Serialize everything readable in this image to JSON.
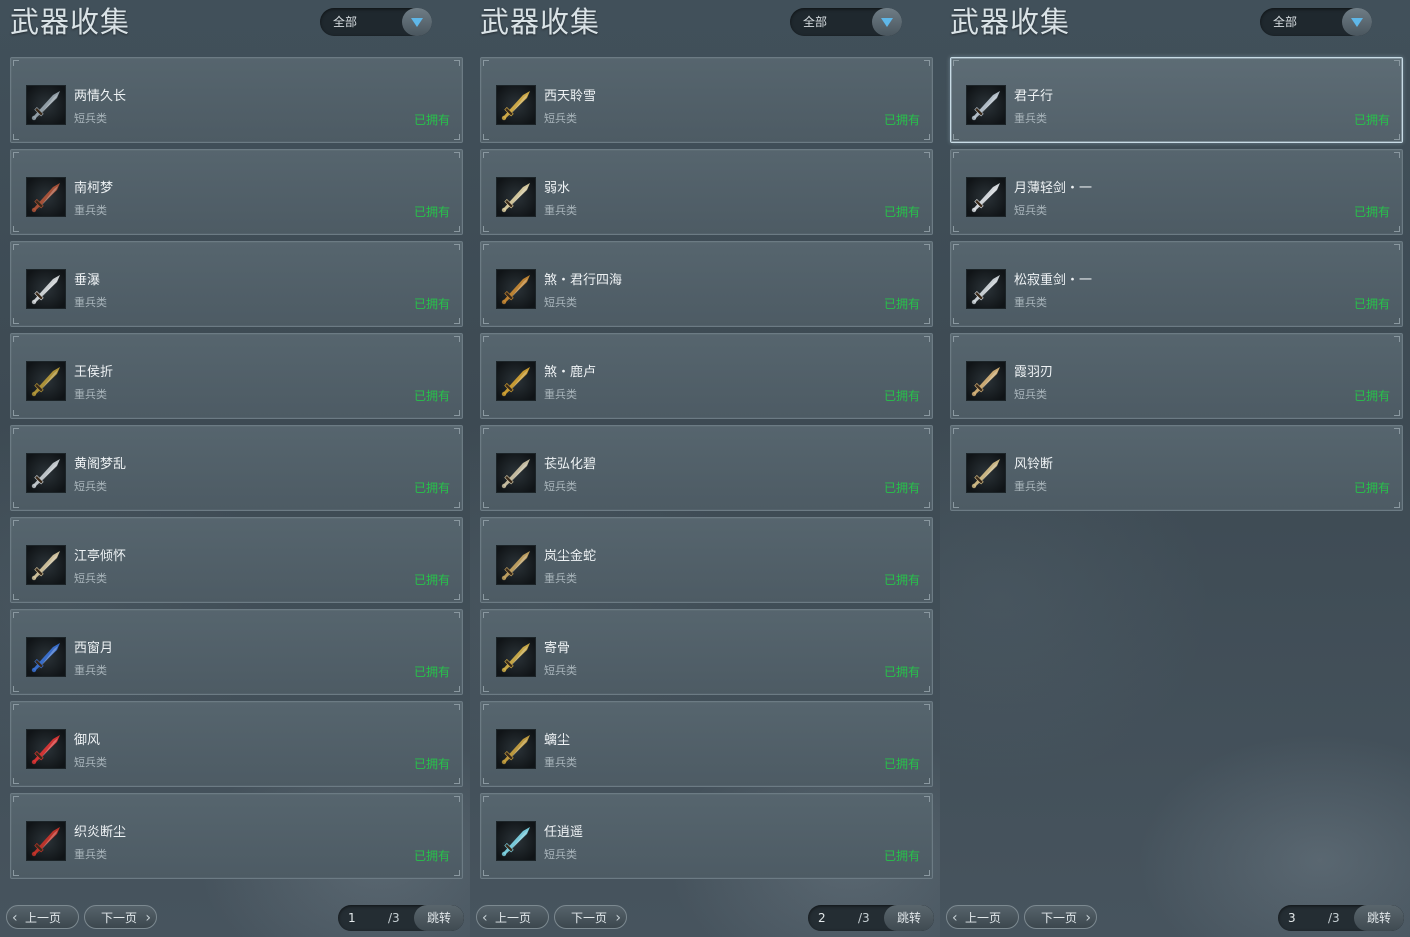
{
  "panels": [
    {
      "title": "武器收集",
      "filter_value": "全部",
      "items": [
        {
          "name": "两情久长",
          "category": "短兵类",
          "status": "已拥有",
          "icon": "sword-icon",
          "color": "#9aa7b0"
        },
        {
          "name": "南柯梦",
          "category": "重兵类",
          "status": "已拥有",
          "icon": "meat-icon",
          "color": "#b0553a"
        },
        {
          "name": "垂瀑",
          "category": "重兵类",
          "status": "已拥有",
          "icon": "curved-blade-icon",
          "color": "#d9dde0"
        },
        {
          "name": "王侯折",
          "category": "重兵类",
          "status": "已拥有",
          "icon": "bracer-icon",
          "color": "#b79a3a"
        },
        {
          "name": "黄阁梦乱",
          "category": "短兵类",
          "status": "已拥有",
          "icon": "axe-icon",
          "color": "#c9cfd4"
        },
        {
          "name": "江亭倾怀",
          "category": "短兵类",
          "status": "已拥有",
          "icon": "dagger-icon",
          "color": "#d8c9a2"
        },
        {
          "name": "西窗月",
          "category": "重兵类",
          "status": "已拥有",
          "icon": "blue-blade-icon",
          "color": "#3b73d6"
        },
        {
          "name": "御风",
          "category": "短兵类",
          "status": "已拥有",
          "icon": "red-wind-icon",
          "color": "#e03535"
        },
        {
          "name": "织炎断尘",
          "category": "重兵类",
          "status": "已拥有",
          "icon": "flame-icon",
          "color": "#c9342a"
        }
      ],
      "pager": {
        "prev": "上一页",
        "next": "下一页",
        "current": "1",
        "total": "/3",
        "jump": "跳转"
      }
    },
    {
      "title": "武器收集",
      "filter_value": "全部",
      "items": [
        {
          "name": "西天聆雪",
          "category": "短兵类",
          "status": "已拥有",
          "icon": "ornate-sword-icon",
          "color": "#d9b24a"
        },
        {
          "name": "弱水",
          "category": "重兵类",
          "status": "已拥有",
          "icon": "long-blade-icon",
          "color": "#e0d2a5"
        },
        {
          "name": "煞・君行四海",
          "category": "短兵类",
          "status": "已拥有",
          "icon": "bronze-sword-icon",
          "color": "#c98a34"
        },
        {
          "name": "煞・鹿卢",
          "category": "重兵类",
          "status": "已拥有",
          "icon": "twin-blade-icon",
          "color": "#d5a433"
        },
        {
          "name": "苌弘化碧",
          "category": "短兵类",
          "status": "已拥有",
          "icon": "ring-blade-icon",
          "color": "#cfc6a8"
        },
        {
          "name": "岚尘金蛇",
          "category": "重兵类",
          "status": "已拥有",
          "icon": "serpent-blade-icon",
          "color": "#c7a664"
        },
        {
          "name": "寄骨",
          "category": "短兵类",
          "status": "已拥有",
          "icon": "bone-sword-icon",
          "color": "#d3b14a"
        },
        {
          "name": "螭尘",
          "category": "重兵类",
          "status": "已拥有",
          "icon": "dragon-sword-icon",
          "color": "#c9a240"
        },
        {
          "name": "任逍遥",
          "category": "短兵类",
          "status": "已拥有",
          "icon": "blue-sword-icon",
          "color": "#7fd6e6"
        }
      ],
      "pager": {
        "prev": "上一页",
        "next": "下一页",
        "current": "2",
        "total": "/3",
        "jump": "跳转"
      }
    },
    {
      "title": "武器收集",
      "filter_value": "全部",
      "items": [
        {
          "name": "君子行",
          "category": "重兵类",
          "status": "已拥有",
          "icon": "steel-blade-icon",
          "color": "#bcc8d2",
          "selected": true
        },
        {
          "name": "月薄轻剑・一",
          "category": "短兵类",
          "status": "已拥有",
          "icon": "light-sword-icon",
          "color": "#dfe4e8"
        },
        {
          "name": "松寂重剑・一",
          "category": "重兵类",
          "status": "已拥有",
          "icon": "heavy-sword-icon",
          "color": "#d5dbe0"
        },
        {
          "name": "霞羽刃",
          "category": "短兵类",
          "status": "已拥有",
          "icon": "feather-blade-icon",
          "color": "#d8b47a"
        },
        {
          "name": "风铃断",
          "category": "重兵类",
          "status": "已拥有",
          "icon": "wide-blade-icon",
          "color": "#d6c08a"
        }
      ],
      "pager": {
        "prev": "上一页",
        "next": "下一页",
        "current": "3",
        "total": "/3",
        "jump": "跳转"
      }
    }
  ]
}
